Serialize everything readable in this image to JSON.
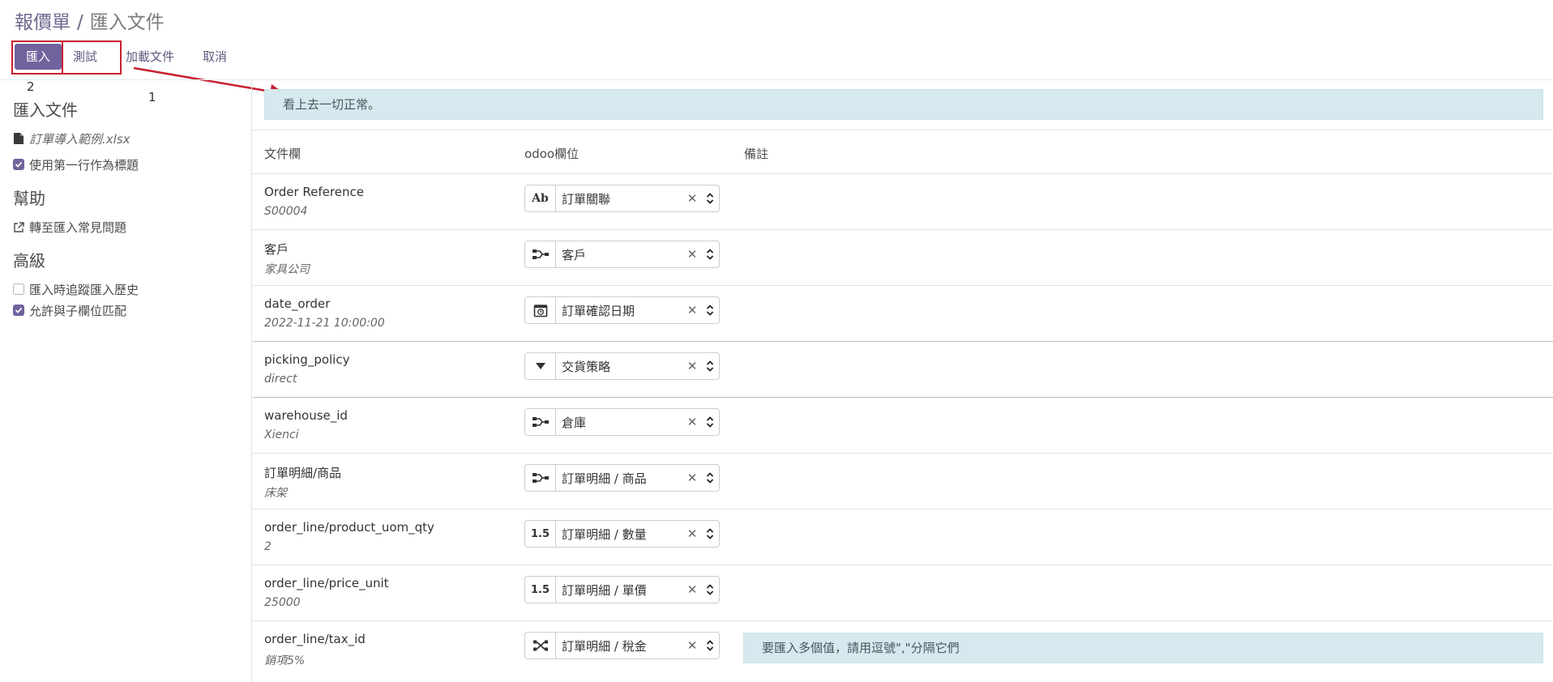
{
  "breadcrumb": {
    "parent": "報價單",
    "separator": "/",
    "current": "匯入文件"
  },
  "toolbar": {
    "import_label": "匯入",
    "test_label": "測試",
    "load_file_label": "加載文件",
    "cancel_label": "取消"
  },
  "annotations": {
    "marker_import": "2",
    "marker_test": "1",
    "highlight_color": "#c7202d"
  },
  "sidebar": {
    "import_file_heading": "匯入文件",
    "file_name": "訂單導入範例.xlsx",
    "use_first_row_header": {
      "label": "使用第一行作為標題",
      "checked": true
    },
    "help_heading": "幫助",
    "faq_link": "轉至匯入常見問題",
    "advanced_heading": "高級",
    "track_history": {
      "label": "匯入時追蹤匯入歷史",
      "checked": false
    },
    "allow_subfield_match": {
      "label": "允許與子欄位匹配",
      "checked": true
    }
  },
  "status_message": "看上去一切正常。",
  "table": {
    "headers": {
      "file_column": "文件欄",
      "odoo_field": "odoo欄位",
      "comment": "備註"
    },
    "rows": [
      {
        "name": "Order Reference",
        "sample": "S00004",
        "field_type": "Ab",
        "type_icon": "text-type-icon",
        "field": "訂單關聯",
        "note": ""
      },
      {
        "name": "客戶",
        "sample": "家具公司",
        "field_type": "",
        "type_icon": "relation-icon",
        "field": "客戶",
        "note": ""
      },
      {
        "name": "date_order",
        "sample": "2022-11-21 10:00:00",
        "field_type": "",
        "type_icon": "calendar-icon",
        "field": "訂單確認日期",
        "note": ""
      },
      {
        "name": "picking_policy",
        "sample": "direct",
        "field_type": "",
        "type_icon": "selection-icon",
        "field": "交貨策略",
        "note": ""
      },
      {
        "name": "warehouse_id",
        "sample": "Xienci",
        "field_type": "",
        "type_icon": "relation-icon",
        "field": "倉庫",
        "note": ""
      },
      {
        "name": "訂單明細/商品",
        "sample": "床架",
        "field_type": "",
        "type_icon": "relation-icon",
        "field": "訂單明細 / 商品",
        "note": ""
      },
      {
        "name": "order_line/product_uom_qty",
        "sample": "2",
        "field_type": "1.5",
        "type_icon": "float-type-icon",
        "field": "訂單明細 / 數量",
        "note": ""
      },
      {
        "name": "order_line/price_unit",
        "sample": "25000",
        "field_type": "1.5",
        "type_icon": "float-type-icon",
        "field": "訂單明細 / 單價",
        "note": ""
      },
      {
        "name": "order_line/tax_id",
        "sample": "銷項5%",
        "field_type": "",
        "type_icon": "many2many-icon",
        "field": "訂單明細 / 稅金",
        "note": "要匯入多個值，請用逗號\",\"分隔它們"
      }
    ]
  },
  "colors": {
    "primary": "#71639e",
    "info_bg": "#d6e9ee",
    "annotation_red": "#c7202d"
  }
}
